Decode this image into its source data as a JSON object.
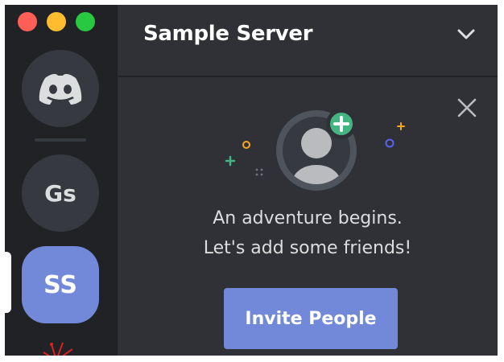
{
  "window": {
    "controls": [
      "close",
      "minimize",
      "zoom"
    ]
  },
  "servers": [
    {
      "id": "home",
      "label": "",
      "icon": "discord-logo-icon"
    },
    {
      "id": "gs",
      "label": "Gs"
    },
    {
      "id": "ss",
      "label": "SS",
      "selected": true
    }
  ],
  "header": {
    "server_name": "Sample Server",
    "dropdown_icon": "chevron-down-icon"
  },
  "welcome": {
    "line1": "An adventure begins.",
    "line2": "Let's add some friends!",
    "invite_label": "Invite People",
    "close_icon": "close-icon"
  },
  "colors": {
    "accent": "#7289da",
    "rail": "#202225",
    "panel": "#2f3136",
    "green": "#43b581"
  }
}
